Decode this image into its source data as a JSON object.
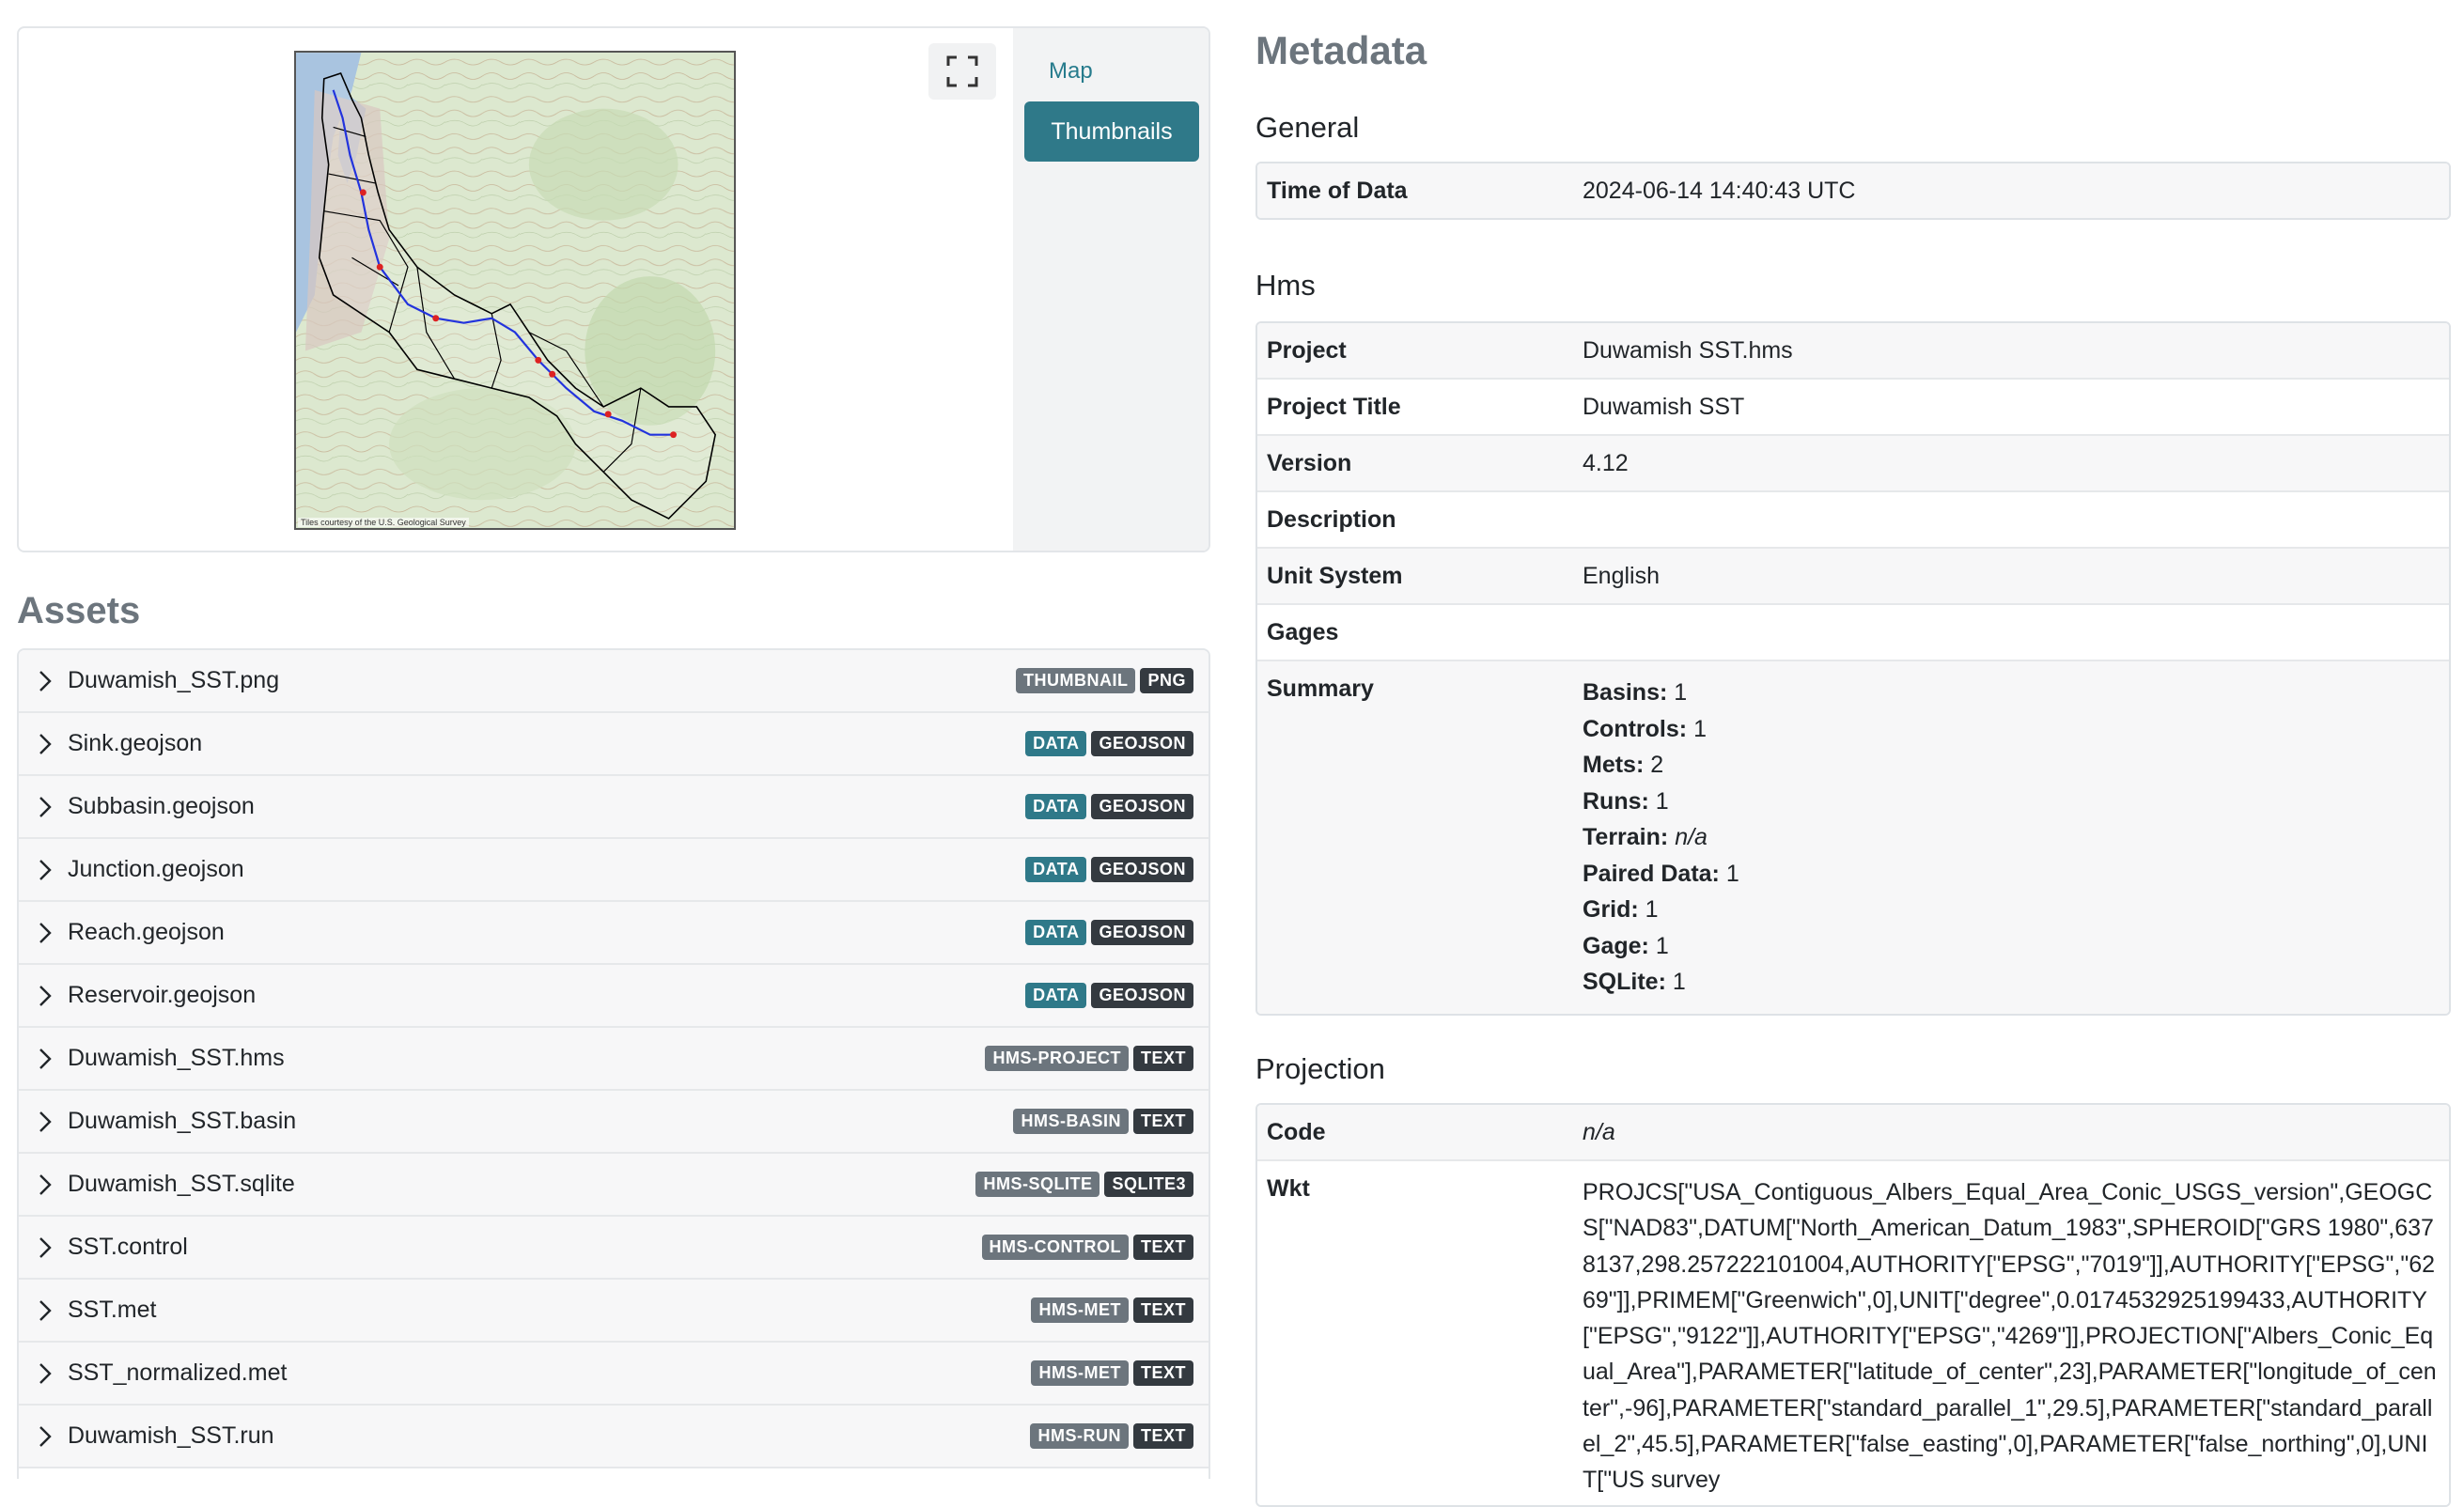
{
  "preview": {
    "map_attribution": "Tiles courtesy of the U.S. Geological Survey",
    "tabs": {
      "map": "Map",
      "thumbnails": "Thumbnails"
    }
  },
  "assets": {
    "title": "Assets",
    "items": [
      {
        "name": "Duwamish_SST.png",
        "badges": [
          {
            "text": "THUMBNAIL",
            "color": "gray"
          },
          {
            "text": "PNG",
            "color": "dark"
          }
        ]
      },
      {
        "name": "Sink.geojson",
        "badges": [
          {
            "text": "DATA",
            "color": "teal"
          },
          {
            "text": "GEOJSON",
            "color": "dark"
          }
        ]
      },
      {
        "name": "Subbasin.geojson",
        "badges": [
          {
            "text": "DATA",
            "color": "teal"
          },
          {
            "text": "GEOJSON",
            "color": "dark"
          }
        ]
      },
      {
        "name": "Junction.geojson",
        "badges": [
          {
            "text": "DATA",
            "color": "teal"
          },
          {
            "text": "GEOJSON",
            "color": "dark"
          }
        ]
      },
      {
        "name": "Reach.geojson",
        "badges": [
          {
            "text": "DATA",
            "color": "teal"
          },
          {
            "text": "GEOJSON",
            "color": "dark"
          }
        ]
      },
      {
        "name": "Reservoir.geojson",
        "badges": [
          {
            "text": "DATA",
            "color": "teal"
          },
          {
            "text": "GEOJSON",
            "color": "dark"
          }
        ]
      },
      {
        "name": "Duwamish_SST.hms",
        "badges": [
          {
            "text": "HMS-PROJECT",
            "color": "gray"
          },
          {
            "text": "TEXT",
            "color": "dark"
          }
        ]
      },
      {
        "name": "Duwamish_SST.basin",
        "badges": [
          {
            "text": "HMS-BASIN",
            "color": "gray"
          },
          {
            "text": "TEXT",
            "color": "dark"
          }
        ]
      },
      {
        "name": "Duwamish_SST.sqlite",
        "badges": [
          {
            "text": "HMS-SQLITE",
            "color": "gray"
          },
          {
            "text": "SQLITE3",
            "color": "dark"
          }
        ]
      },
      {
        "name": "SST.control",
        "badges": [
          {
            "text": "HMS-CONTROL",
            "color": "gray"
          },
          {
            "text": "TEXT",
            "color": "dark"
          }
        ]
      },
      {
        "name": "SST.met",
        "badges": [
          {
            "text": "HMS-MET",
            "color": "gray"
          },
          {
            "text": "TEXT",
            "color": "dark"
          }
        ]
      },
      {
        "name": "SST_normalized.met",
        "badges": [
          {
            "text": "HMS-MET",
            "color": "gray"
          },
          {
            "text": "TEXT",
            "color": "dark"
          }
        ]
      },
      {
        "name": "Duwamish_SST.run",
        "badges": [
          {
            "text": "HMS-RUN",
            "color": "gray"
          },
          {
            "text": "TEXT",
            "color": "dark"
          }
        ]
      }
    ]
  },
  "metadata": {
    "title": "Metadata",
    "general": {
      "heading": "General",
      "time_label": "Time of Data",
      "time_value": "2024-06-14 14:40:43 UTC"
    },
    "hms": {
      "heading": "Hms",
      "project_label": "Project",
      "project_value": "Duwamish SST.hms",
      "project_title_label": "Project Title",
      "project_title_value": "Duwamish SST",
      "version_label": "Version",
      "version_value": "4.12",
      "description_label": "Description",
      "unit_system_label": "Unit System",
      "unit_system_value": "English",
      "gages_label": "Gages",
      "summary_label": "Summary",
      "summary": [
        {
          "key": "Basins:",
          "value": "1",
          "italic": false
        },
        {
          "key": "Controls:",
          "value": "1",
          "italic": false
        },
        {
          "key": "Mets:",
          "value": "2",
          "italic": false
        },
        {
          "key": "Runs:",
          "value": "1",
          "italic": false
        },
        {
          "key": "Terrain:",
          "value": "n/a",
          "italic": true
        },
        {
          "key": "Paired Data:",
          "value": "1",
          "italic": false
        },
        {
          "key": "Grid:",
          "value": "1",
          "italic": false
        },
        {
          "key": "Gage:",
          "value": "1",
          "italic": false
        },
        {
          "key": "SQLite:",
          "value": "1",
          "italic": false
        }
      ]
    },
    "projection": {
      "heading": "Projection",
      "code_label": "Code",
      "code_value": "n/a",
      "wkt_label": "Wkt",
      "wkt_value": "PROJCS[\"USA_Contiguous_Albers_Equal_Area_Conic_USGS_version\",GEOGCS[\"NAD83\",DATUM[\"North_American_Datum_1983\",SPHEROID[\"GRS 1980\",6378137,298.257222101004,AUTHORITY[\"EPSG\",\"7019\"]],AUTHORITY[\"EPSG\",\"6269\"]],PRIMEM[\"Greenwich\",0],UNIT[\"degree\",0.0174532925199433,AUTHORITY[\"EPSG\",\"9122\"]],AUTHORITY[\"EPSG\",\"4269\"]],PROJECTION[\"Albers_Conic_Equal_Area\"],PARAMETER[\"latitude_of_center\",23],PARAMETER[\"longitude_of_center\",-96],PARAMETER[\"standard_parallel_1\",29.5],PARAMETER[\"standard_parallel_2\",45.5],PARAMETER[\"false_easting\",0],PARAMETER[\"false_northing\",0],UNIT[\"US survey"
    }
  },
  "colors": {
    "accent": "#2f7989",
    "badge_gray": "#6c757d",
    "badge_dark": "#343a40",
    "watershed_outline": "#000000",
    "river_line": "#2233dd",
    "junction_point": "#dd2222"
  },
  "icons": [
    "fullscreen-icon",
    "chevron-right-icon"
  ]
}
